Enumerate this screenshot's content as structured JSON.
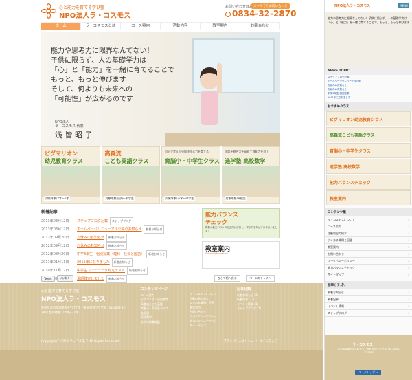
{
  "header": {
    "tagline": "心と能力を育てる学び塾",
    "brand": "NPO法人ラ・コスモス",
    "contact_label": "お問い合わせはお気軽に！",
    "phone": "0834-32-2870",
    "mail_button": "メールでのお問い合わせ"
  },
  "nav": [
    {
      "label": "ホーム",
      "active": true
    },
    {
      "label": "ラ・コスモスとは"
    },
    {
      "label": "コース案内"
    },
    {
      "label": "活動内容"
    },
    {
      "label": "教室案内"
    },
    {
      "label": "お問合わせ"
    }
  ],
  "hero": {
    "lines": [
      "能力や思考力に限界なんてない！",
      "子供に限らず、人の基礎学力は",
      "「心」と「能力」を一緒に育てることで",
      "もっと、もっと伸びます",
      "そして、何よりも未来への",
      "「可能性」が広がるのです"
    ],
    "org": "NPO法人",
    "rep_title": "ラ・コスモス 代表",
    "rep_name": "浅 皆 昭 子"
  },
  "banners": [
    {
      "t1": "ピグマリオン",
      "t2": "幼児教育クラス",
      "label": "対象年齢/2才〜6才"
    },
    {
      "t1": "高森流",
      "t2": "こども英語クラス",
      "label": "対象年齢/幼児〜中学生"
    },
    {
      "t1small": "自分で考え自分解決する力を育てる",
      "t2": "育脳小・中学生クラス",
      "label": "対象年齢/小学〜中学生"
    },
    {
      "t1small": "国語を総合力を高めて理解力を向上",
      "t2": "進学塾 高校数学",
      "label": "対象年齢/高校生"
    }
  ],
  "news": {
    "title": "新着記事",
    "items": [
      {
        "date": "2013年03月12日",
        "title": "ステップブログ記載",
        "tag": "ステップブログ"
      },
      {
        "date": "2013年03月12日",
        "title": "ホームページリニューアル公開のお知らせ",
        "tag": "新着お知らせ"
      },
      {
        "date": "2012年09月20日",
        "title": "お休みのお知らせ",
        "tag": "新着お知らせ"
      },
      {
        "date": "2012年09月12日",
        "title": "お休みのお知らせ",
        "tag": "新着お知らせ"
      },
      {
        "date": "2012年08月20日",
        "title": "中学3年生　個別授業（理科・社会と国語）",
        "tag": "新着お知らせ"
      },
      {
        "date": "2011年01月11日",
        "title": "2011年になりました",
        "tag": "新着お知らせ"
      },
      {
        "date": "2010年11月12日",
        "title": "中学生コンピュータ判定テスト",
        "tag": "新着お知らせ"
      },
      {
        "date": "2010年07月09日",
        "title": "夏期教室しました",
        "tag": "新着お知らせ"
      }
    ]
  },
  "side_ads": {
    "ad1_a": "能力バランス",
    "ad1_b": "チェック",
    "ad1_c": "算数の能力バランスを正確に診断し、学ぶ力を伸ばすお手伝いをします",
    "ad2_a": "教室案内",
    "ad2_c": "School information"
  },
  "social": {
    "tweet": "Tweet",
    "like": "いいね！",
    "totop": "ひとつ前へ戻る",
    "pagetop": "ページのトップへ"
  },
  "footer": {
    "tagline": "心と能力を育てる学び塾",
    "brand": "NPO法人ラ・コスモス",
    "address": "防府市 山口県周南市平生町大字・鍋島 防府プラザ3F TEL.0834-32-2870 受付時間：14時〜22時",
    "col1_title": "コンテンツページ",
    "col1": [
      "コース案内",
      "ピグマリオン幼児教育",
      "高森流こども英語",
      "育脳小・中学生クラス",
      "進学塾",
      "高校数学",
      "佐竹市教育相談"
    ],
    "col2": [
      "ラ・コスモスについて",
      "活動内容の紹介",
      "よくある質問と回答",
      "教室案内",
      "お問い合わせ",
      "プライバシーポリシー",
      "能力バランスチェック",
      "サイトマップ"
    ],
    "col3_title": "記事分類",
    "col3": [
      "新着お知らせ (3)",
      "新着記事 (13)",
      "イベント情報 (1)",
      "ステップブログ (1)"
    ],
    "copyright": "Copyright(C)2013 ラ・コスモス All Rights Reserved.",
    "links": "プライバシーポリシー ｜ サイトマップ"
  },
  "mobile": {
    "brand": "NPO法人ラ・コスモス",
    "menu": "MENU",
    "hero_copy": "能力や思考力に限界なんてない！子供に限らず、人の基礎学力は「心」と「能力」を一緒に育てることで、もっと、もっと伸びます",
    "news_title": "NEWS TOPIC",
    "news_items": [
      "ステップブログ記載",
      "ホームページリニューアル公開",
      "お休みのお知らせ",
      "お休みのお知らせ",
      "中学3年生 個別授業",
      "2011年になりました"
    ],
    "courses_title": "おすすめクラス",
    "courses": [
      {
        "text": "ピグマリオン幼児教育クラス",
        "green": false
      },
      {
        "text": "高森流こども英語クラス",
        "green": true
      },
      {
        "text": "育脳小・中学生クラス",
        "green": false
      },
      {
        "text": "進学塾 高校数学",
        "green": false
      },
      {
        "text": "能力バランスチェック",
        "green": false
      },
      {
        "text": "教室案内",
        "green": false
      }
    ],
    "contents_title": "コンテンツ集",
    "contents": [
      "ラ・コスモスについて",
      "コース案内",
      "活動内容の紹介",
      "よくある質問と回答",
      "教室案内",
      "お問い合わせ",
      "プライバシーポリシー",
      "能力バランスチェック",
      "サイトマップ"
    ],
    "blog_title": "記事カテゴリ",
    "blog": [
      "新着お知らせ",
      "新着記事",
      "イベント情報",
      "ステップブログ"
    ],
    "foot_brand": "ラ・コスモス",
    "foot_addr": "山口県周南市平生町大字・鍋島 防府プラザ3F TEL.0834-32-2870",
    "top_btn": "ページトップへ"
  }
}
